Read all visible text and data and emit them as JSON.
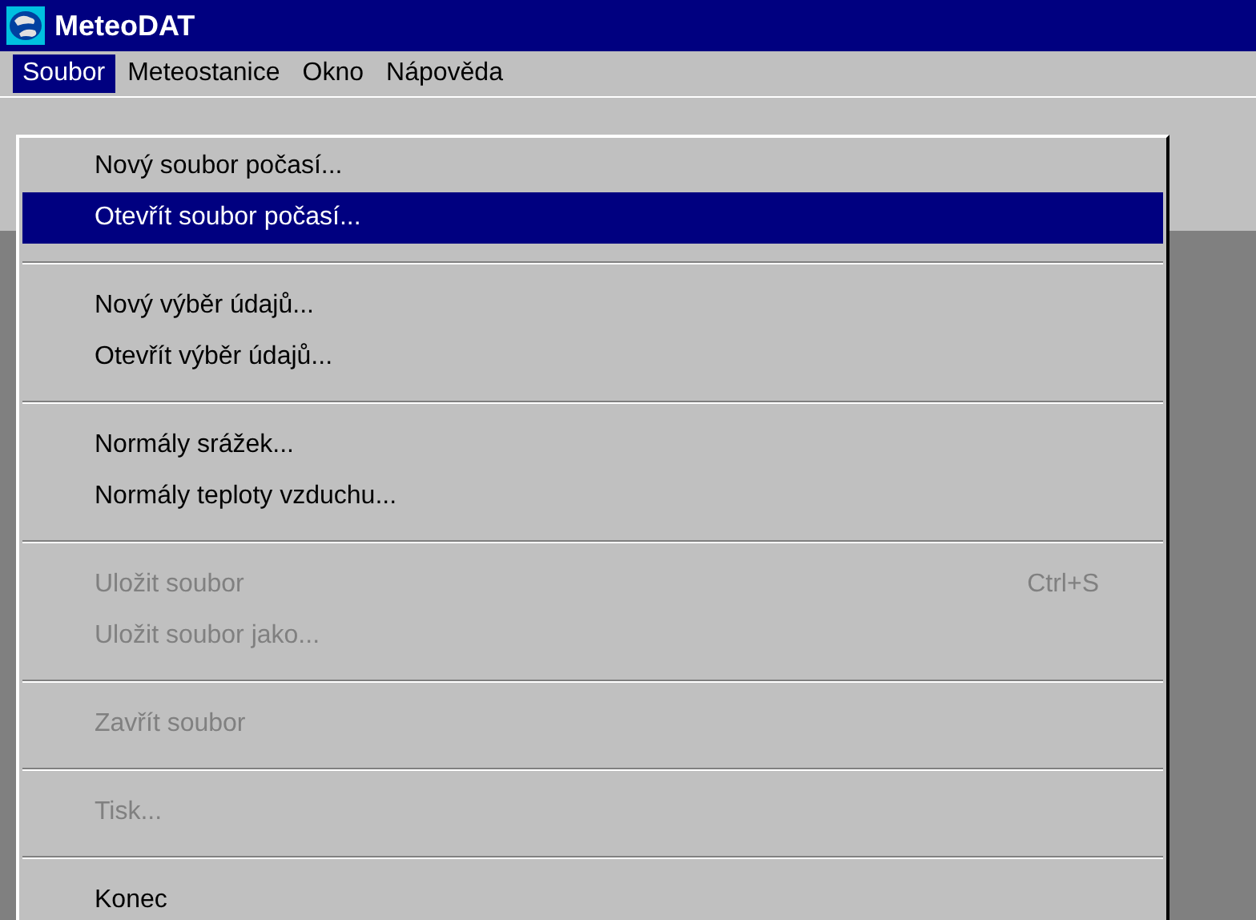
{
  "window": {
    "title": "MeteoDAT"
  },
  "menubar": [
    {
      "label": "Soubor",
      "selected": true
    },
    {
      "label": "Meteostanice",
      "selected": false
    },
    {
      "label": "Okno",
      "selected": false
    },
    {
      "label": "Nápověda",
      "selected": false
    }
  ],
  "menu": [
    {
      "kind": "item",
      "label": "Nový soubor počasí...",
      "selected": false,
      "disabled": false
    },
    {
      "kind": "item",
      "label": "Otevřít soubor počasí...",
      "selected": true,
      "disabled": false
    },
    {
      "kind": "separator"
    },
    {
      "kind": "item",
      "label": "Nový výběr údajů...",
      "selected": false,
      "disabled": false
    },
    {
      "kind": "item",
      "label": "Otevřít výběr údajů...",
      "selected": false,
      "disabled": false
    },
    {
      "kind": "separator"
    },
    {
      "kind": "item",
      "label": "Normály srážek...",
      "selected": false,
      "disabled": false
    },
    {
      "kind": "item",
      "label": "Normály teploty vzduchu...",
      "selected": false,
      "disabled": false
    },
    {
      "kind": "separator"
    },
    {
      "kind": "item",
      "label": "Uložit soubor",
      "shortcut": "Ctrl+S",
      "selected": false,
      "disabled": true
    },
    {
      "kind": "item",
      "label": "Uložit soubor jako...",
      "selected": false,
      "disabled": true
    },
    {
      "kind": "separator"
    },
    {
      "kind": "item",
      "label": "Zavřít soubor",
      "selected": false,
      "disabled": true
    },
    {
      "kind": "separator"
    },
    {
      "kind": "item",
      "label": "Tisk...",
      "selected": false,
      "disabled": true
    },
    {
      "kind": "separator"
    },
    {
      "kind": "item",
      "label": "Konec",
      "selected": false,
      "disabled": false
    }
  ]
}
